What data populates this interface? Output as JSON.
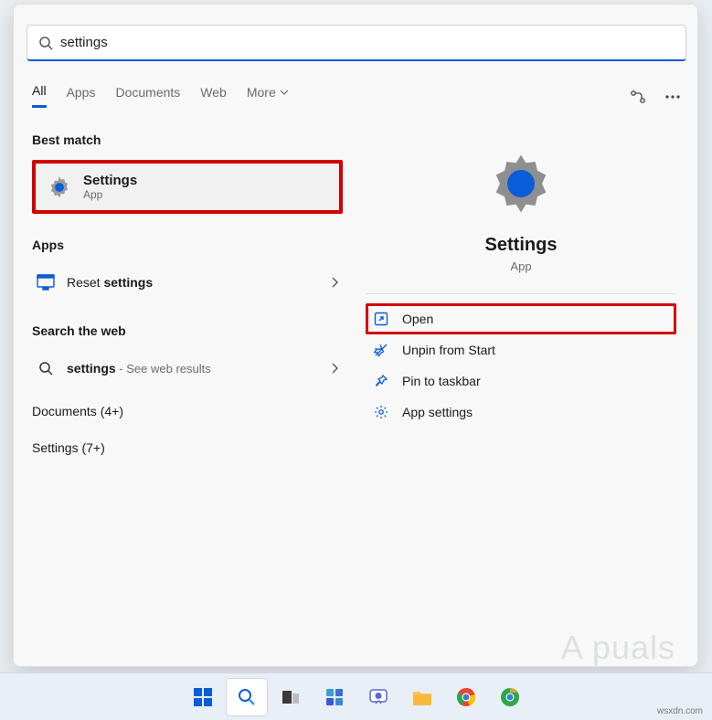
{
  "search": {
    "query": "settings"
  },
  "tabs": {
    "all": "All",
    "apps": "Apps",
    "documents": "Documents",
    "web": "Web",
    "more": "More"
  },
  "left": {
    "best_match_heading": "Best match",
    "best_match_name": "Settings",
    "best_match_sub": "App",
    "apps_heading": "Apps",
    "reset_settings_pre": "Reset ",
    "reset_settings_bold": "settings",
    "web_heading": "Search the web",
    "web_item_bold": "settings",
    "web_item_dash": " - ",
    "web_item_sub": "See web results",
    "docs_more": "Documents (4+)",
    "settings_more": "Settings (7+)"
  },
  "right": {
    "title": "Settings",
    "subtitle": "App",
    "actions": {
      "open": "Open",
      "unpin": "Unpin from Start",
      "pin_taskbar": "Pin to taskbar",
      "app_settings": "App settings"
    }
  },
  "watermark": "wsxdn.com"
}
